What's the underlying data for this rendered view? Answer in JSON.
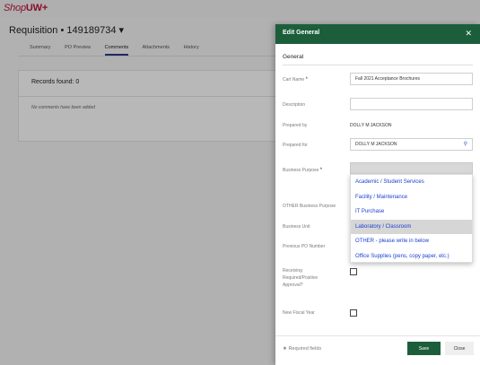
{
  "app": {
    "logo_shop": "Shop",
    "logo_uw": "UW",
    "logo_plus": "+"
  },
  "page": {
    "title": "Requisition • 149189734 ▾",
    "tabs": [
      "Summary",
      "PO Preview",
      "Comments",
      "Attachments",
      "History"
    ],
    "active_tab": "Comments",
    "records_found": "Records found: 0",
    "no_comments": "No comments have been added"
  },
  "panel": {
    "title": "Edit General",
    "close_icon": "close-icon",
    "section": "General",
    "fields": {
      "cart_name": {
        "label": "Cart Name",
        "value": "Fall 2021 Acceptance Brochures"
      },
      "description": {
        "label": "Description",
        "value": ""
      },
      "prepared_by": {
        "label": "Prepared by",
        "value": "DOLLY M JACKSON"
      },
      "prepared_for": {
        "label": "Prepared for",
        "value": "DOLLY M JACKSON"
      },
      "business_purpose": {
        "label": "Business Purpose",
        "value": ""
      },
      "other_business_purpose": {
        "label": "OTHER Business Purpose"
      },
      "business_unit": {
        "label": "Business Unit"
      },
      "previous_po": {
        "label": "Previous PO Number"
      },
      "receiving": {
        "label_1": "Receiving",
        "label_2": "Required/Positive",
        "label_3": "Approval?"
      },
      "new_fiscal_year": {
        "label": "New Fiscal Year"
      }
    },
    "required_star": "*",
    "business_purpose_options": [
      "Academic / Student Services",
      "Facility / Maintenance",
      "IT Purchase",
      "Laboratory / Classroom",
      "OTHER - please write in below",
      "Office Supplies (pens, copy paper, etc.)"
    ],
    "highlighted_option": "Laboratory / Classroom",
    "footer": {
      "required_note": "★ Required fields",
      "save": "Save",
      "close": "Close"
    }
  },
  "colors": {
    "header_green": "#1c5e3b",
    "brand_red": "#c0143c",
    "link_blue": "#1a3fd0"
  }
}
